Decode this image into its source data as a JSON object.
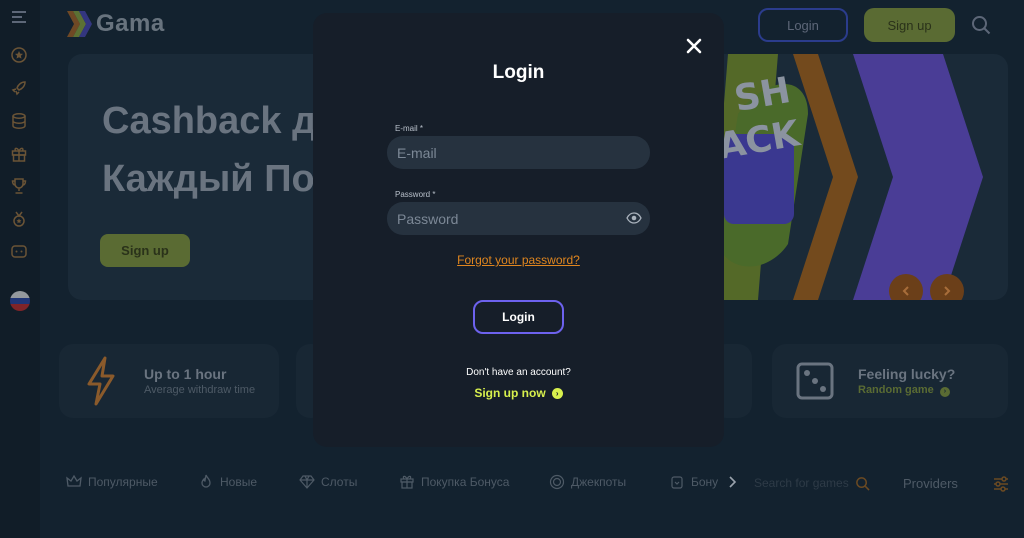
{
  "header": {
    "logo_text": "Gama",
    "login_label": "Login",
    "signup_label": "Sign up"
  },
  "banner": {
    "title_line1": "Cashback д",
    "title_line2": "Каждый По",
    "signup_label": "Sign up",
    "art_text_1": "SH",
    "art_text_2": "ACK"
  },
  "cards": [
    {
      "title": "Up to 1 hour",
      "subtitle": "Average withdraw time"
    },
    {
      "title": "Feeling lucky?",
      "subtitle": "Random game"
    }
  ],
  "categories": [
    {
      "label": "Популярные",
      "icon": "crown-icon"
    },
    {
      "label": "Новые",
      "icon": "fire-icon"
    },
    {
      "label": "Слоты",
      "icon": "diamond-icon"
    },
    {
      "label": "Покупка Бонуса",
      "icon": "gift-icon"
    },
    {
      "label": "Джекпоты",
      "icon": "coin-icon"
    },
    {
      "label": "Бону",
      "icon": "bonus-icon"
    }
  ],
  "search_placeholder": "Search for games",
  "providers_label": "Providers",
  "modal": {
    "title": "Login",
    "email_label": "E-mail *",
    "email_placeholder": "E-mail",
    "password_label": "Password *",
    "password_placeholder": "Password",
    "forgot_label": "Forgot your password?",
    "login_button": "Login",
    "no_account": "Don't have an account?",
    "signup_now": "Sign up now"
  },
  "colors": {
    "accent_purple": "#6d62ee",
    "accent_orange": "#e0861f",
    "accent_green": "#d8f04d"
  }
}
